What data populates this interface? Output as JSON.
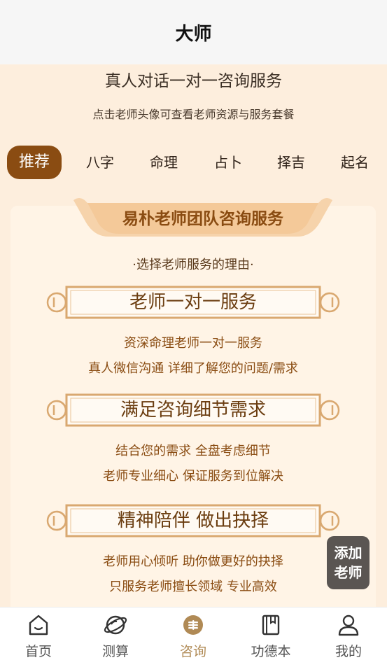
{
  "header": {
    "title": "大师"
  },
  "main": {
    "heading": "真人对话一对一咨询服务",
    "subheading": "点击老师头像可查看老师资源与服务套餐"
  },
  "tabs": [
    {
      "label": "推荐",
      "active": true
    },
    {
      "label": "八字"
    },
    {
      "label": "命理"
    },
    {
      "label": "占卜"
    },
    {
      "label": "择吉"
    },
    {
      "label": "起名"
    }
  ],
  "card": {
    "ribbon_title": "易朴老师团队咨询服务",
    "reason_title": "·选择老师服务的理由·",
    "sections": [
      {
        "title": "老师一对一服务",
        "lines": [
          "资深命理老师一对一服务",
          "真人微信沟通  详细了解您的问题/需求"
        ]
      },
      {
        "title": "满足咨询细节需求",
        "lines": [
          "结合您的需求 全盘考虑细节",
          "老师专业细心 保证服务到位解决"
        ]
      },
      {
        "title": "精神陪伴 做出抉择",
        "lines": [
          "老师用心倾听 助你做更好的抉择",
          "只服务老师擅长领域  专业高效"
        ]
      }
    ]
  },
  "float_button": {
    "line1": "添加",
    "line2": "老师"
  },
  "bottom_nav": [
    {
      "label": "首页",
      "icon": "home-icon"
    },
    {
      "label": "测算",
      "icon": "planet-icon"
    },
    {
      "label": "咨询",
      "icon": "consult-icon",
      "active": true
    },
    {
      "label": "功德本",
      "icon": "book-icon"
    },
    {
      "label": "我的",
      "icon": "user-icon"
    }
  ],
  "colors": {
    "accent": "#8a4c12",
    "background": "#fdeedd",
    "nav_active": "#b08a55"
  }
}
